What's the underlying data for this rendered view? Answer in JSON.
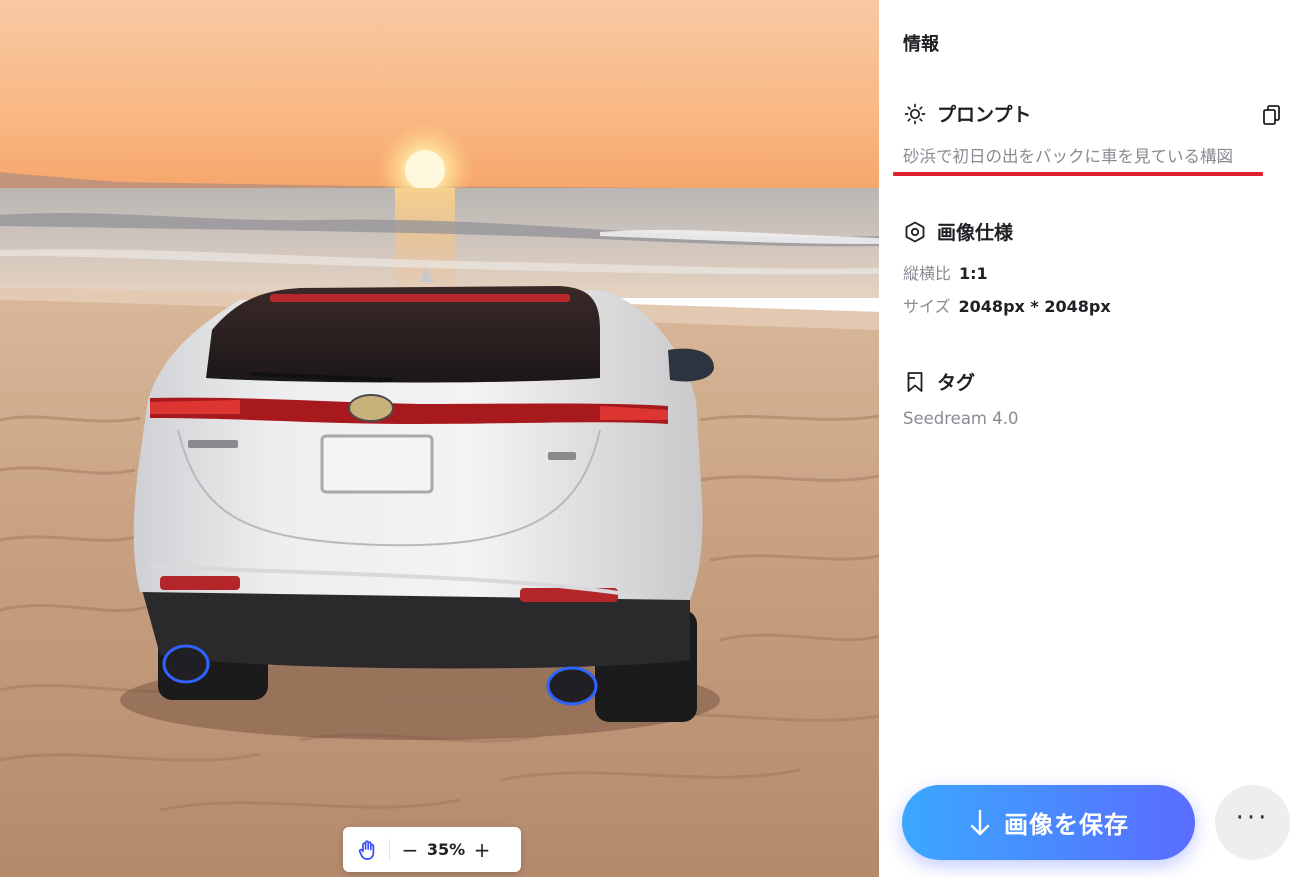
{
  "viewer": {
    "zoom_level": "35%",
    "zoom_out_glyph": "−",
    "zoom_in_glyph": "+",
    "hand_tool_icon": "hand-icon"
  },
  "panel": {
    "title": "情報",
    "prompt": {
      "heading": "プロンプト",
      "text": "砂浜で初日の出をバックに車を見ている構図",
      "icon": "sun-icon",
      "copy_icon": "copy-icon"
    },
    "spec": {
      "heading": "画像仕様",
      "icon": "hexagon-settings-icon",
      "aspect_label": "縦横比",
      "aspect_value": "1:1",
      "size_label": "サイズ",
      "size_value": "2048px * 2048px"
    },
    "tags": {
      "heading": "タグ",
      "icon": "bookmark-icon",
      "value": "Seedream 4.0"
    },
    "save_label": "画像を保存",
    "more_glyph": "···"
  },
  "colors": {
    "accent_gradient_start": "#3aa8ff",
    "accent_gradient_end": "#5a6cff",
    "highlight_underline": "#e0202c",
    "muted_text": "#8a8a93"
  }
}
